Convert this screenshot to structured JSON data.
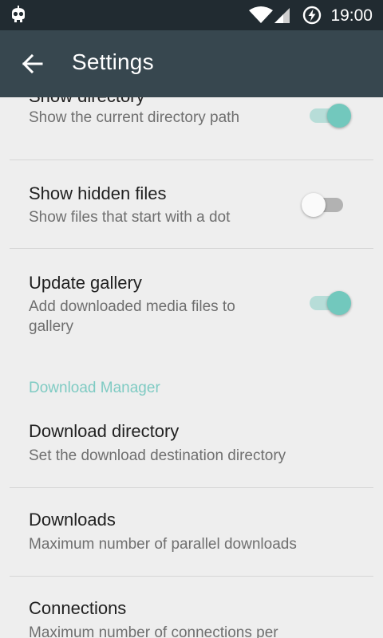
{
  "status_bar": {
    "time": "19:00",
    "left_icon": "android-debug-icon",
    "icons": [
      "wifi-icon",
      "signal-icon",
      "battery-charging-icon"
    ]
  },
  "app_bar": {
    "title": "Settings",
    "back_icon": "arrow-back-icon",
    "background_color": "#37474f"
  },
  "preferences": [
    {
      "title": "Show directory",
      "summary": "Show the current directory path",
      "switch_on": true
    },
    {
      "title": "Show hidden files",
      "summary": "Show files that start with a dot",
      "switch_on": false
    },
    {
      "title": "Update gallery",
      "summary": "Add downloaded media files to gallery",
      "switch_on": true
    }
  ],
  "category": {
    "label": "Download Manager",
    "color": "#7fcbc3"
  },
  "download_preferences": [
    {
      "title": "Download directory",
      "summary": "Set the download destination directory"
    },
    {
      "title": "Downloads",
      "summary": "Maximum number of parallel downloads"
    },
    {
      "title": "Connections",
      "summary": "Maximum number of connections per"
    }
  ],
  "accent_color": "#72c8bd"
}
